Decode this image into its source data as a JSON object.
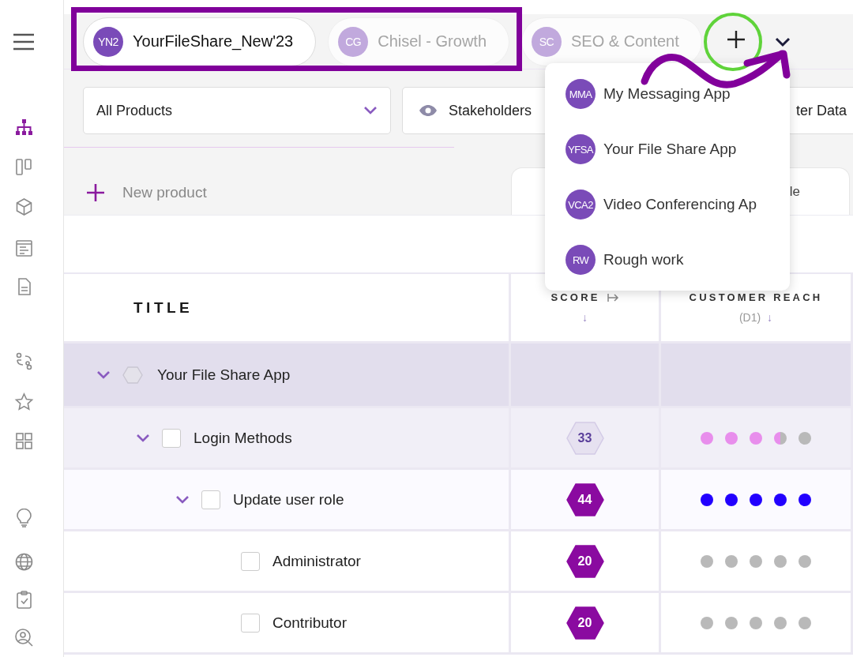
{
  "tabs": [
    {
      "initials": "YN2",
      "label": "YourFileShare_New'23",
      "selected": true
    },
    {
      "initials": "CG",
      "label": "Chisel - Growth",
      "selected": false
    },
    {
      "initials": "SC",
      "label": "SEO & Content",
      "selected": false
    }
  ],
  "sidebar": {
    "items": [
      {
        "selected": true
      },
      {
        "selected": false
      },
      {
        "selected": false
      },
      {
        "selected": false
      },
      {
        "selected": false
      },
      {
        "selected": false
      },
      {
        "selected": false
      },
      {
        "selected": false
      },
      {
        "selected": false
      },
      {
        "selected": false
      },
      {
        "selected": false
      },
      {
        "selected": false
      }
    ]
  },
  "toolbar": {
    "product_filter": "All Products",
    "buttons": [
      {
        "label": "Stakeholders",
        "kind": "eye"
      },
      {
        "label": "ter Data",
        "kind": "plain"
      }
    ]
  },
  "new_product": {
    "label": "New product"
  },
  "view_tabs": [
    {
      "label": "le"
    }
  ],
  "table": {
    "columns": [
      {
        "label": "TITLE"
      },
      {
        "label": "SCORE",
        "sort": "↓"
      },
      {
        "label": "CUSTOMER REACH",
        "note": "(D1)",
        "sort": "↓"
      }
    ],
    "rows": [
      {
        "title": "Your File Share App",
        "kind": "product",
        "expanded": true,
        "children": [
          {
            "title": "Login Methods",
            "kind": "feature",
            "checked": false,
            "expanded": true,
            "score": "33",
            "score_muted": true,
            "stars": 3.5,
            "color": "#e88eec",
            "children": [
              {
                "title": "Update user role",
                "kind": "feature",
                "checked": false,
                "expanded": true,
                "score": "44",
                "score_muted": false,
                "stars": 5,
                "color": "#2200ff",
                "children": [
                  {
                    "title": "Administrator",
                    "kind": "feature",
                    "checked": false,
                    "expanded": false,
                    "score": "20",
                    "score_muted": false,
                    "stars": 0
                  },
                  {
                    "title": "Contributor",
                    "kind": "feature",
                    "checked": false,
                    "expanded": false,
                    "score": "20",
                    "score_muted": false,
                    "stars": 0
                  }
                ]
              }
            ]
          }
        ]
      }
    ]
  },
  "menu": {
    "items": [
      {
        "initials": "MMA",
        "label": "My Messaging App"
      },
      {
        "initials": "YFSA",
        "label": "Your File Share App"
      },
      {
        "initials": "VCA2",
        "label": "Video Conferencing Ap"
      },
      {
        "initials": "RW",
        "label": "Rough work"
      }
    ]
  }
}
